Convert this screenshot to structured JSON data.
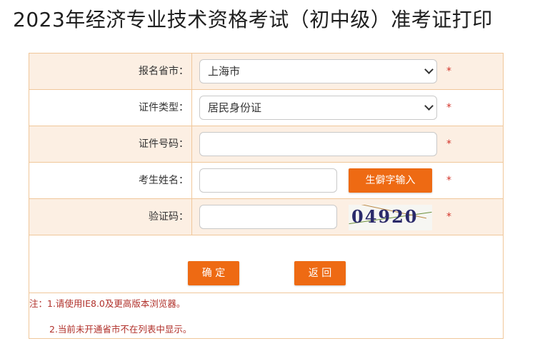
{
  "page": {
    "title": "2023年经济专业技术资格考试（初中级）准考证打印"
  },
  "form": {
    "province_label": "报名省市：",
    "province_value": "上海市",
    "idtype_label": "证件类型：",
    "idtype_value": "居民身份证",
    "idnumber_label": "证件号码：",
    "idnumber_value": "",
    "name_label": "考生姓名：",
    "name_value": "",
    "rare_char_button": "生僻字输入",
    "captcha_label": "验证码：",
    "captcha_value": "",
    "captcha_image_text": "04920",
    "required_mark": "*",
    "confirm_button": "确 定",
    "back_button": "返 回"
  },
  "notes": {
    "note1": "注：1.请使用IE8.0及更高版本浏览器。",
    "note2": "2.当前未开通省市不在列表中显示。"
  },
  "colors": {
    "accent": "#ee6a13",
    "row_shade": "#fcefe3",
    "border": "#f0c79a",
    "required": "#d3342a",
    "note_text": "#b0302a"
  },
  "icons": {
    "select_arrow": "chevron-down-icon"
  }
}
